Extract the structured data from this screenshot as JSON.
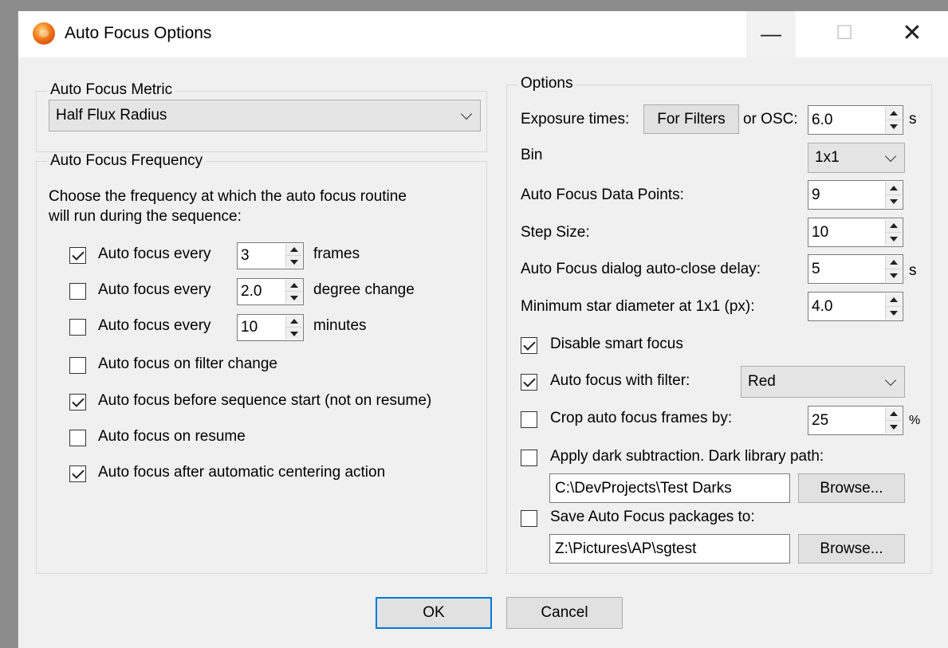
{
  "window": {
    "title": "Auto Focus Options",
    "minimize": "—",
    "maximize": "☐",
    "close": "✕"
  },
  "metric_group": {
    "legend": "Auto Focus Metric",
    "selected": "Half Flux Radius"
  },
  "frequency_group": {
    "legend": "Auto Focus Frequency",
    "description_line1": "Choose the frequency at which the auto focus routine",
    "description_line2": "will run during the sequence:",
    "every_frames": {
      "checked": true,
      "label": "Auto focus every",
      "value": "3",
      "unit": "frames"
    },
    "every_degree": {
      "checked": false,
      "label": "Auto focus every",
      "value": "2.0",
      "unit": "degree change"
    },
    "every_minutes": {
      "checked": false,
      "label": "Auto focus every",
      "value": "10",
      "unit": "minutes"
    },
    "on_filter_change": {
      "checked": false,
      "label": "Auto focus on filter change"
    },
    "before_sequence": {
      "checked": true,
      "label": "Auto focus before sequence start (not on resume)"
    },
    "on_resume": {
      "checked": false,
      "label": "Auto focus on resume"
    },
    "after_centering": {
      "checked": true,
      "label": "Auto focus after automatic centering action"
    }
  },
  "options_group": {
    "legend": "Options",
    "exposure_label": "Exposure times:",
    "for_filters_button": "For Filters",
    "or_osc_label": "or OSC:",
    "osc_value": "6.0",
    "osc_unit": "s",
    "bin_label": "Bin",
    "bin_value": "1x1",
    "data_points_label": "Auto Focus Data Points:",
    "data_points_value": "9",
    "step_size_label": "Step Size:",
    "step_size_value": "10",
    "autoclose_label": "Auto Focus dialog auto-close delay:",
    "autoclose_value": "5",
    "autoclose_unit": "s",
    "min_star_label": "Minimum star diameter at 1x1 (px):",
    "min_star_value": "4.0",
    "disable_smart": {
      "checked": true,
      "label": "Disable smart focus"
    },
    "with_filter": {
      "checked": true,
      "label": "Auto focus with filter:",
      "value": "Red"
    },
    "crop": {
      "checked": false,
      "label": "Crop auto focus frames by:",
      "value": "25",
      "unit": "%"
    },
    "dark_sub": {
      "checked": false,
      "label": "Apply dark subtraction.  Dark library path:",
      "path": "C:\\DevProjects\\Test Darks",
      "browse": "Browse..."
    },
    "save_packages": {
      "checked": false,
      "label": "Save Auto Focus packages to:",
      "path": "Z:\\Pictures\\AP\\sgtest",
      "browse": "Browse..."
    }
  },
  "footer": {
    "ok": "OK",
    "cancel": "Cancel"
  }
}
